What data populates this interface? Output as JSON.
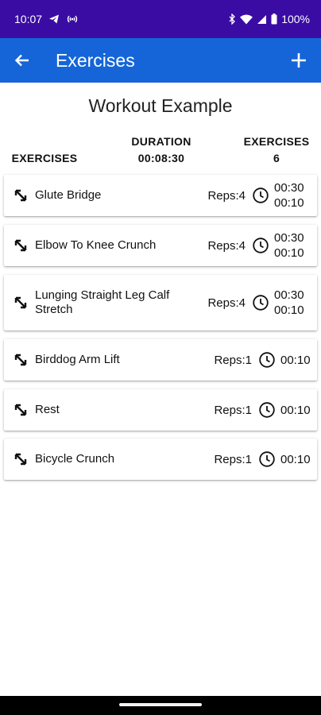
{
  "status_bar": {
    "time": "10:07",
    "battery": "100%"
  },
  "app_bar": {
    "title": "Exercises"
  },
  "workout": {
    "title": "Workout Example",
    "summary": {
      "exercises_label": "EXERCISES",
      "duration_label": "DURATION",
      "duration_value": "00:08:30",
      "exercises_count_label": "EXERCISES",
      "exercises_count_value": "6"
    }
  },
  "exercises": [
    {
      "name": "Glute Bridge",
      "reps": "Reps:4",
      "time1": "00:30",
      "time2": "00:10"
    },
    {
      "name": "Elbow To Knee Crunch",
      "reps": "Reps:4",
      "time1": "00:30",
      "time2": "00:10"
    },
    {
      "name": "Lunging Straight Leg Calf Stretch",
      "reps": "Reps:4",
      "time1": "00:30",
      "time2": "00:10"
    },
    {
      "name": "Birddog Arm Lift",
      "reps": "Reps:1",
      "time1": "00:10"
    },
    {
      "name": "Rest",
      "reps": "Reps:1",
      "time1": "00:10"
    },
    {
      "name": "Bicycle Crunch",
      "reps": "Reps:1",
      "time1": "00:10"
    }
  ],
  "colors": {
    "status_bar": "#3a0ca3",
    "app_bar": "#1565d8"
  }
}
